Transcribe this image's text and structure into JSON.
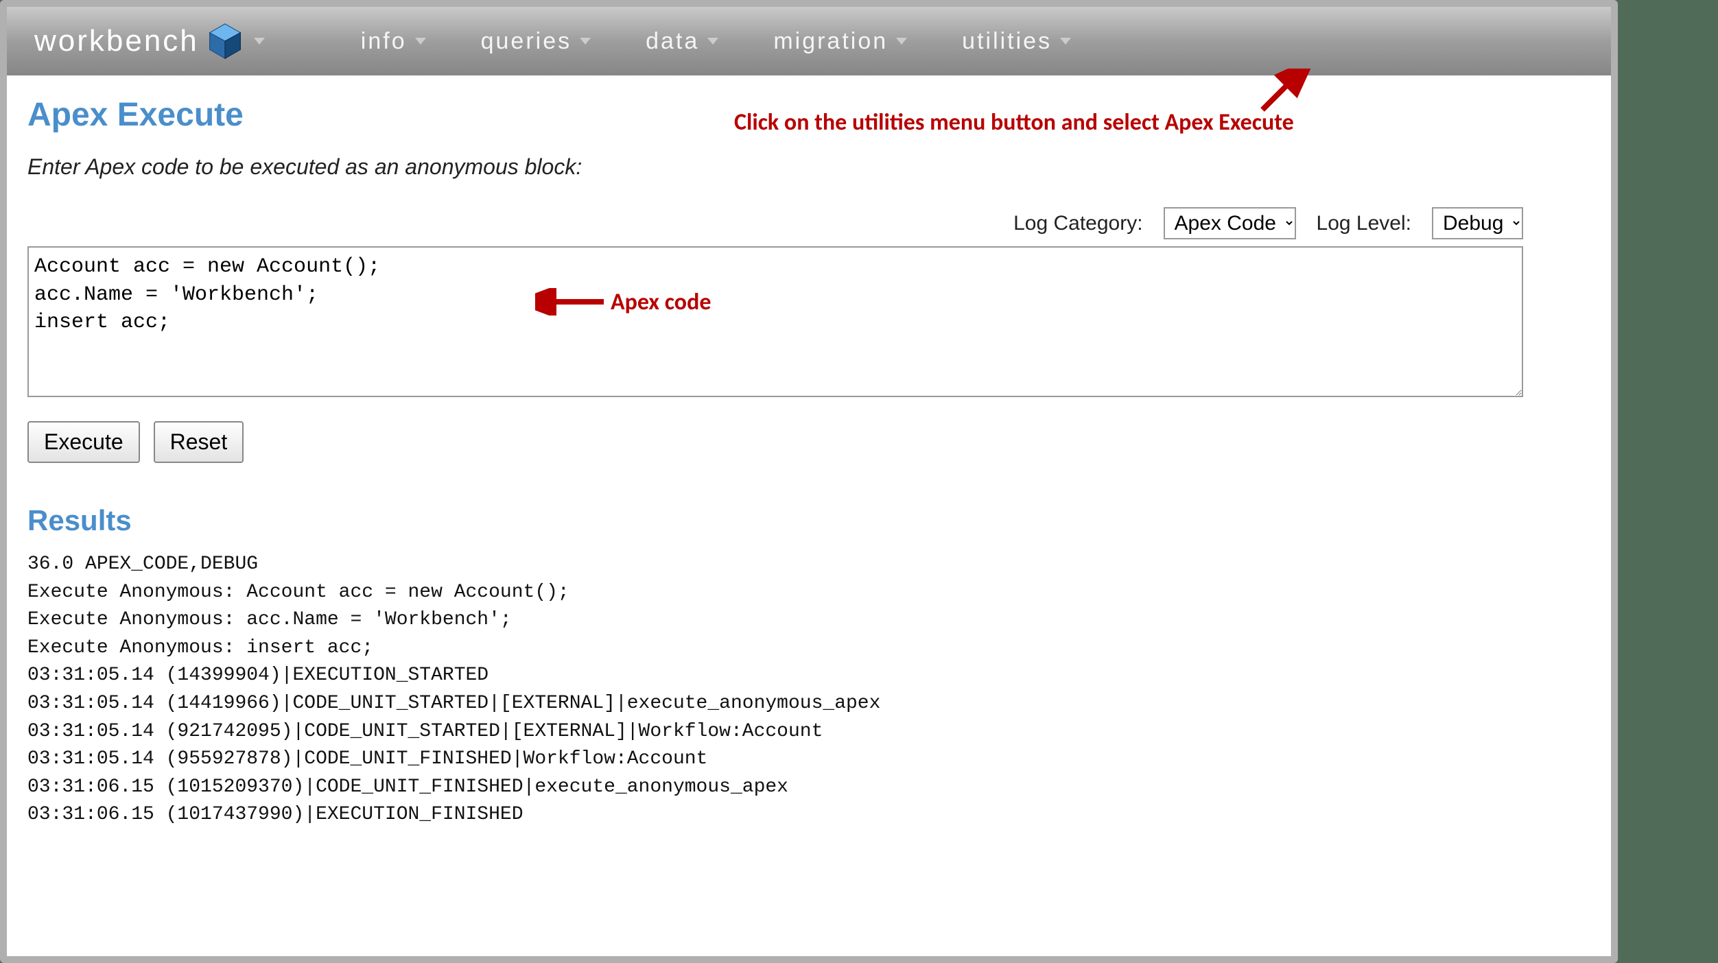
{
  "brand": {
    "name": "workbench"
  },
  "nav": {
    "info": "info",
    "queries": "queries",
    "data": "data",
    "migration": "migration",
    "utilities": "utilities"
  },
  "page": {
    "title": "Apex Execute",
    "instruction": "Enter Apex code to be executed as an anonymous block:",
    "log_category_label": "Log Category:",
    "log_category_value": "Apex Code",
    "log_level_label": "Log Level:",
    "log_level_value": "Debug",
    "apex_code": "Account acc = new Account();\nacc.Name = 'Workbench';\ninsert acc;",
    "execute_label": "Execute",
    "reset_label": "Reset",
    "results_title": "Results",
    "results_text": "36.0 APEX_CODE,DEBUG\nExecute Anonymous: Account acc = new Account();\nExecute Anonymous: acc.Name = 'Workbench';\nExecute Anonymous: insert acc;\n03:31:05.14 (14399904)|EXECUTION_STARTED\n03:31:05.14 (14419966)|CODE_UNIT_STARTED|[EXTERNAL]|execute_anonymous_apex\n03:31:05.14 (921742095)|CODE_UNIT_STARTED|[EXTERNAL]|Workflow:Account\n03:31:05.14 (955927878)|CODE_UNIT_FINISHED|Workflow:Account\n03:31:06.15 (1015209370)|CODE_UNIT_FINISHED|execute_anonymous_apex\n03:31:06.15 (1017437990)|EXECUTION_FINISHED"
  },
  "annotations": {
    "top_text": "Click on the utilities menu button and select Apex Execute",
    "code_label": "Apex code"
  }
}
